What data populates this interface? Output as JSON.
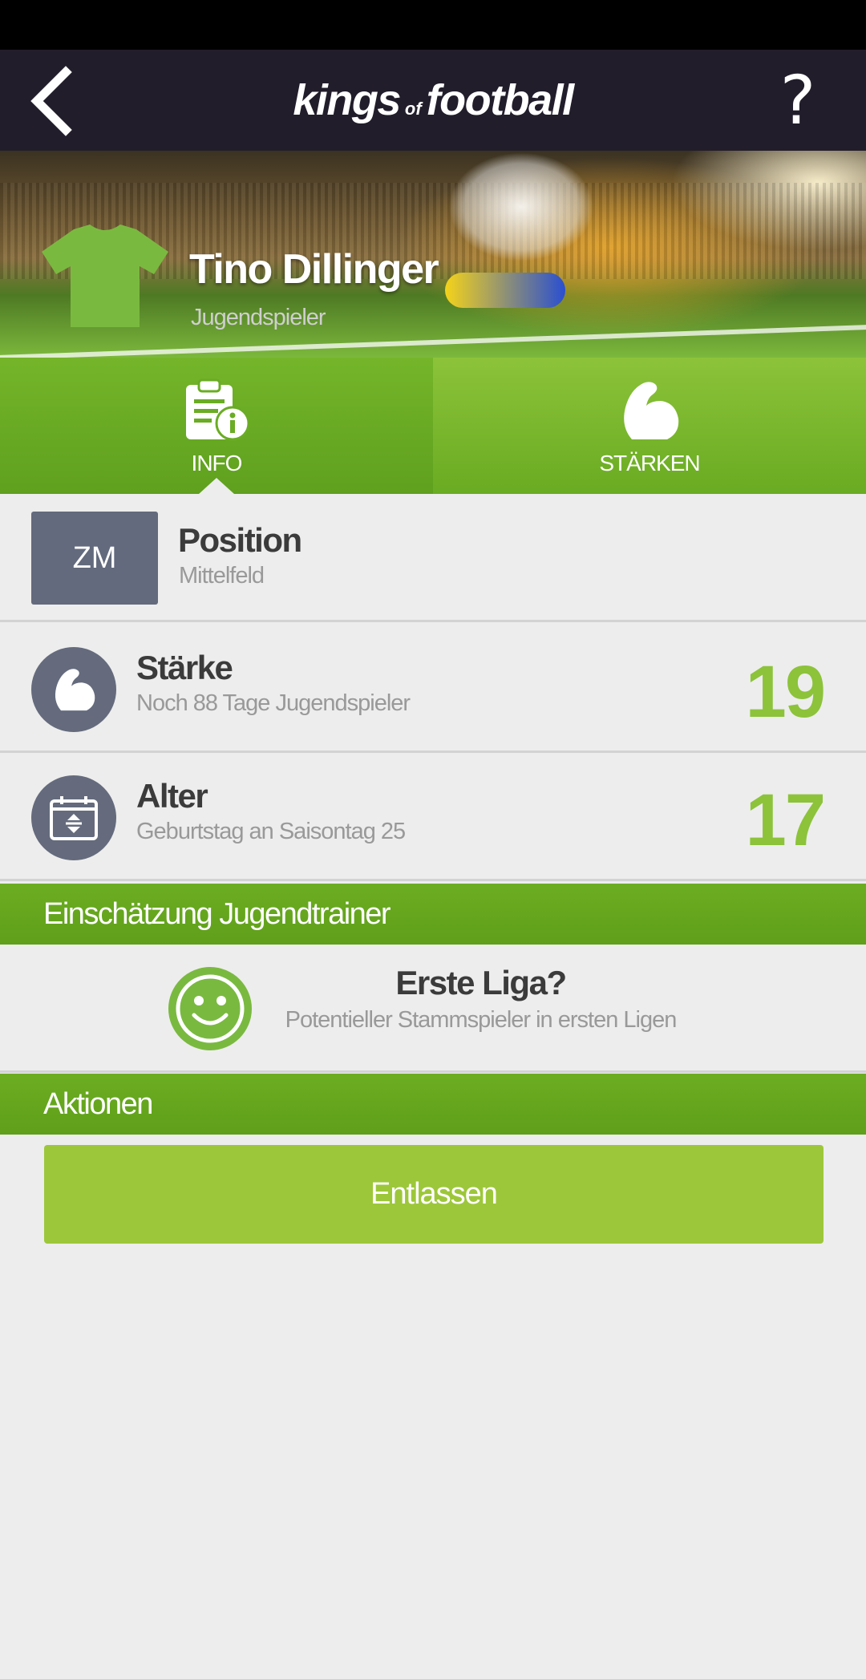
{
  "header": {
    "logo_part1": "kings",
    "logo_of": "of",
    "logo_part2": "football",
    "help_label": "?"
  },
  "player": {
    "name": "Tino Dillinger",
    "role": "Jugendspieler",
    "jersey_color": "#7ab940"
  },
  "tabs": [
    {
      "label": "INFO",
      "icon": "clipboard-info-icon",
      "active": true
    },
    {
      "label": "STÄRKEN",
      "icon": "flexed-arm-icon",
      "active": false
    }
  ],
  "info_rows": {
    "position": {
      "badge": "ZM",
      "title": "Position",
      "subtitle": "Mittelfeld"
    },
    "strength": {
      "title": "Stärke",
      "subtitle": "Noch 88 Tage Jugendspieler",
      "value": "19",
      "icon": "flexed-arm-icon"
    },
    "age": {
      "title": "Alter",
      "subtitle": "Geburtstag an Saisontag 25",
      "value": "17",
      "icon": "calendar-icon"
    }
  },
  "assessment": {
    "header": "Einschätzung Jugendtrainer",
    "title": "Erste Liga?",
    "subtitle": "Potentieller Stammspieler in ersten Ligen",
    "icon": "smiley-icon"
  },
  "actions": {
    "header": "Aktionen",
    "dismiss_label": "Entlassen"
  },
  "colors": {
    "appbar": "#221d2b",
    "green": "#6cad22",
    "accent_value": "#8cc33a",
    "button": "#9dc73a",
    "badge": "#636a7d"
  }
}
